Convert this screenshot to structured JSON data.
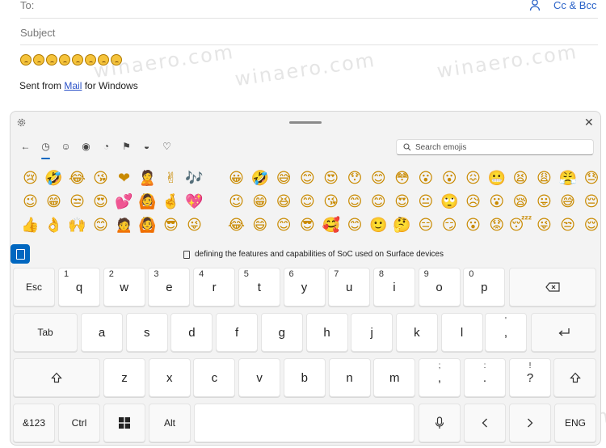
{
  "compose": {
    "to_label": "To:",
    "cc_bcc": "Cc & Bcc",
    "subject_placeholder": "Subject",
    "body_emoji_count": 8,
    "signature_prefix": "Sent from ",
    "signature_link": "Mail",
    "signature_suffix": " for Windows"
  },
  "watermark": "winaero.com",
  "panel": {
    "categories": [
      {
        "name": "back-icon",
        "glyph": "←"
      },
      {
        "name": "recent-icon",
        "glyph": "◷"
      },
      {
        "name": "smiley-icon",
        "glyph": "☺"
      },
      {
        "name": "people-icon",
        "glyph": "◉"
      },
      {
        "name": "food-icon",
        "glyph": "◔"
      },
      {
        "name": "flag-icon",
        "glyph": "⚑"
      },
      {
        "name": "car-icon",
        "glyph": "◒"
      },
      {
        "name": "heart-icon",
        "glyph": "♡"
      }
    ],
    "search_placeholder": "Search emojis",
    "recent_emojis": [
      "😢",
      "🤣",
      "😂",
      "😘",
      "❤",
      "🙎",
      "✌",
      "🎶",
      "😉",
      "😁",
      "😒",
      "😍",
      "💕",
      "🙆",
      "🤞",
      "💖",
      "👍",
      "👌",
      "🙌",
      "😊",
      "🙍",
      "🙆",
      "😎",
      "😜"
    ],
    "all_emojis": [
      "😀",
      "🤣",
      "😅",
      "😊",
      "😍",
      "😯",
      "😊",
      "😳",
      "😮",
      "😮",
      "😖",
      "😬",
      "😫",
      "😩",
      "😤",
      "😓",
      "😉",
      "😁",
      "😆",
      "😊",
      "😘",
      "😊",
      "😊",
      "😍",
      "😐",
      "🙄",
      "😥",
      "😮",
      "😪",
      "😛",
      "😅",
      "😔",
      "😂",
      "😄",
      "😊",
      "😎",
      "🥰",
      "😊",
      "🙂",
      "🤔",
      "😑",
      "😏",
      "😮",
      "😟",
      "😴",
      "😜",
      "😒",
      "😌"
    ],
    "suggestion": "defining the features and capabilities of SoC used on Surface devices"
  },
  "keyboard": {
    "row1": [
      {
        "label": "Esc",
        "num": ""
      },
      {
        "label": "q",
        "num": "1"
      },
      {
        "label": "w",
        "num": "2"
      },
      {
        "label": "e",
        "num": "3"
      },
      {
        "label": "r",
        "num": "4"
      },
      {
        "label": "t",
        "num": "5"
      },
      {
        "label": "y",
        "num": "6"
      },
      {
        "label": "u",
        "num": "7"
      },
      {
        "label": "i",
        "num": "8"
      },
      {
        "label": "o",
        "num": "9"
      },
      {
        "label": "p",
        "num": "0"
      }
    ],
    "row2": [
      "Tab",
      "a",
      "s",
      "d",
      "f",
      "g",
      "h",
      "j",
      "k",
      "l"
    ],
    "row2_punct": {
      "main": ",",
      "sub": "'"
    },
    "row3": [
      "z",
      "x",
      "c",
      "v",
      "b",
      "n",
      "m"
    ],
    "row3_punct": [
      {
        "main": ",",
        "sub": ";"
      },
      {
        "main": ".",
        "sub": ":"
      },
      {
        "main": "?",
        "sub": "!"
      }
    ],
    "row4": {
      "sym": "&123",
      "ctrl": "Ctrl",
      "alt": "Alt",
      "lang": "ENG"
    }
  }
}
